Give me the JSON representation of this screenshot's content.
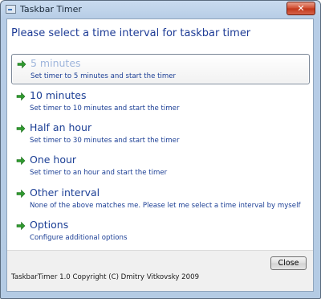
{
  "window": {
    "title": "Taskbar Timer",
    "close_glyph": "✕"
  },
  "heading": "Please select a time interval for taskbar timer",
  "tasks": [
    {
      "title": "5 minutes",
      "description": "Set timer to 5 minutes and start the timer",
      "selected": true
    },
    {
      "title": "10 minutes",
      "description": "Set timer to 10 minutes and start the timer",
      "selected": false
    },
    {
      "title": "Half an hour",
      "description": "Set timer to 30 minutes and start the timer",
      "selected": false
    },
    {
      "title": "One hour",
      "description": "Set timer to an hour and start the timer",
      "selected": false
    },
    {
      "title": "Other interval",
      "description": "None of the above matches me. Please let me select a time interval by myself",
      "selected": false
    },
    {
      "title": "Options",
      "description": "Configure additional options",
      "selected": false
    }
  ],
  "footer": {
    "close_label": "Close",
    "copyright": "TaskbarTimer 1.0 Copyright (C) Dmitry Vitkovsky 2009"
  },
  "colors": {
    "accent_text": "#1c3f95",
    "arrow_green": "#2f9b2f"
  },
  "icons": {
    "task_arrow": "green-arrow-icon",
    "app": "app-icon",
    "window_close": "close-icon"
  }
}
